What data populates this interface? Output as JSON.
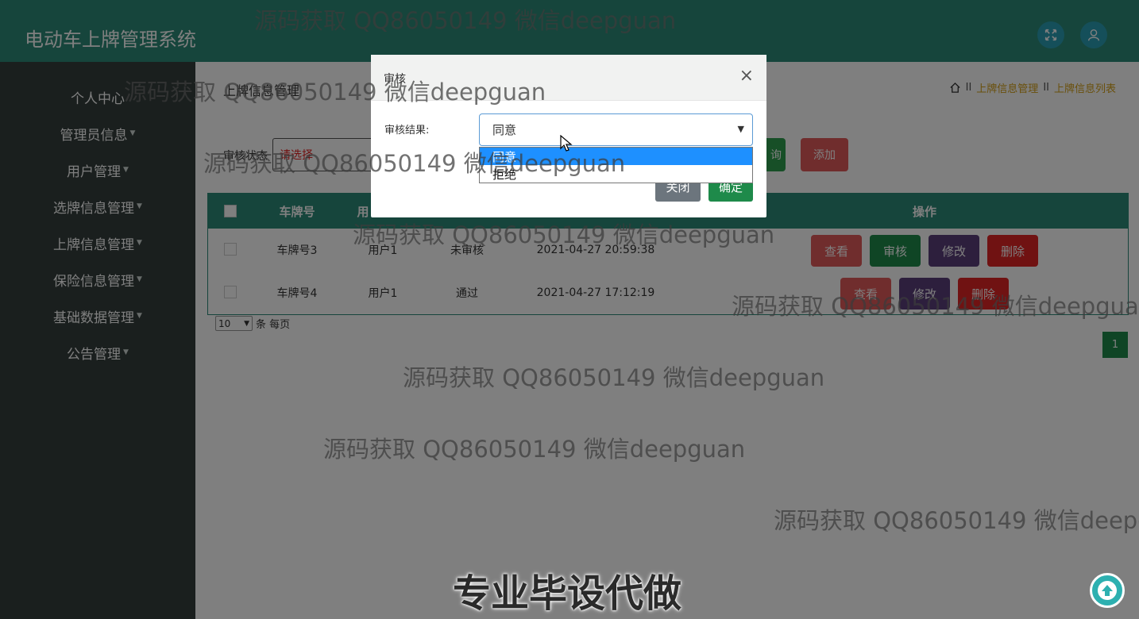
{
  "app": {
    "title": "电动车上牌管理系统"
  },
  "sidebar": {
    "items": [
      {
        "label": "个人中心",
        "has_caret": false
      },
      {
        "label": "管理员信息",
        "has_caret": true
      },
      {
        "label": "用户管理",
        "has_caret": true
      },
      {
        "label": "选牌信息管理",
        "has_caret": true
      },
      {
        "label": "上牌信息管理",
        "has_caret": true
      },
      {
        "label": "保险信息管理",
        "has_caret": true
      },
      {
        "label": "基础数据管理",
        "has_caret": true
      },
      {
        "label": "公告管理",
        "has_caret": true
      }
    ]
  },
  "page": {
    "section_title": "上牌信息管理",
    "breadcrumb": [
      "上牌信息管理",
      "上牌信息列表"
    ],
    "breadcrumb_sep": "II",
    "filter_label": "审核状态",
    "filter_placeholder": "请选择",
    "search_label": "询",
    "add_label": "添加"
  },
  "table": {
    "columns": [
      "车牌号",
      "用",
      "操作"
    ],
    "rows": [
      {
        "plate": "车牌号3",
        "user": "用户1",
        "status": "未审核",
        "time": "2021-04-27 20:59:38",
        "actions": [
          "查看",
          "审核",
          "修改",
          "删除"
        ]
      },
      {
        "plate": "车牌号4",
        "user": "用户1",
        "status": "通过",
        "time": "2021-04-27 17:12:19",
        "actions": [
          "查看",
          "修改",
          "删除"
        ]
      }
    ]
  },
  "pagination": {
    "per_page_value": "10",
    "per_page_suffix": "条 每页",
    "current_page": "1"
  },
  "modal": {
    "title": "审核",
    "close_symbol": "×",
    "field_label": "审核结果:",
    "selected_value": "同意",
    "options": [
      "同意",
      "拒绝"
    ],
    "close_button": "关闭",
    "ok_button": "确定"
  },
  "watermarks": {
    "text": "源码获取 QQ86050149 微信deepguan",
    "bottom_banner": "专业毕设代做"
  },
  "colors": {
    "header": "#2d8a78",
    "sidebar": "#343f3d",
    "accent_green": "#1e8a4a",
    "danger": "#e02424",
    "selected_option": "#1e90ff"
  },
  "icons": [
    "fullscreen-icon",
    "user-icon",
    "home-icon",
    "arrow-up-icon",
    "cursor-icon"
  ]
}
